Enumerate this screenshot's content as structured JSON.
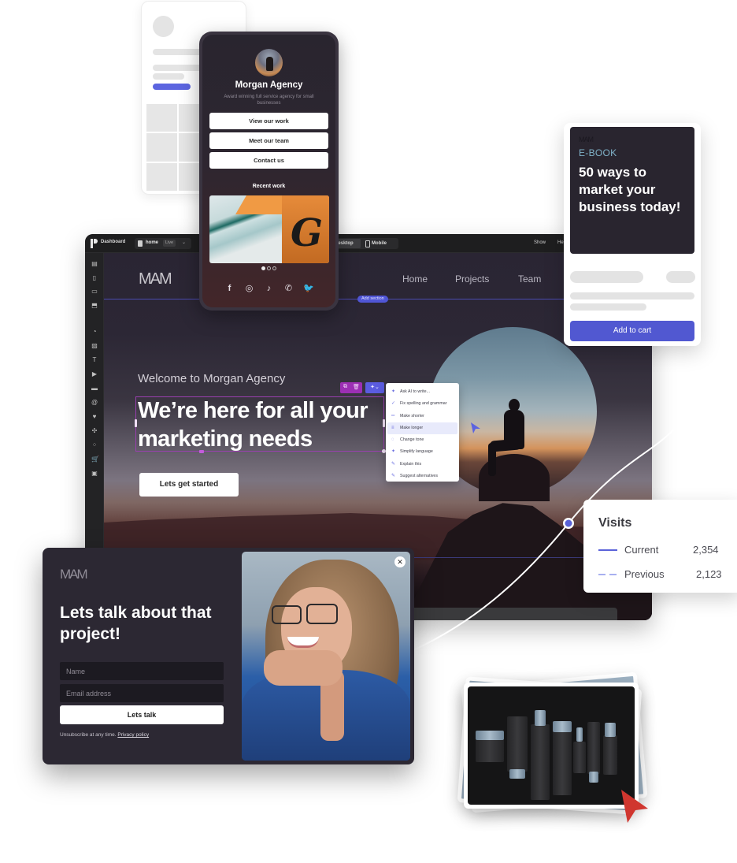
{
  "wireframe_card": {},
  "mobile_preview": {
    "title": "Morgan Agency",
    "subtitle": "Award winning full service agency for small businesses",
    "buttons": [
      "View our work",
      "Meet our team",
      "Contact us"
    ],
    "recent_work_label": "Recent work",
    "carousel": {
      "total": 3,
      "active": 1
    },
    "social_icons": [
      "facebook-icon",
      "instagram-icon",
      "tiktok-icon",
      "whatsapp-icon",
      "twitter-icon"
    ],
    "social_glyphs": [
      "f",
      "◎",
      "♪",
      "✆",
      "🐦"
    ]
  },
  "editor": {
    "topbar": {
      "dashboard_label": "Dashboard",
      "page_name": "home",
      "page_status": "Live",
      "device_desktop": "Desktop",
      "device_mobile": "Mobile",
      "show_label": "Show",
      "help_label": "He"
    },
    "sidebar_icons": [
      "pages-icon",
      "page-icon",
      "section-icon",
      "bookmark-icon",
      "shapes-icon",
      "image-icon",
      "text-icon",
      "video-icon",
      "button-icon",
      "email-icon",
      "heart-icon",
      "widget-icon",
      "apps-icon",
      "cart-icon",
      "gallery-icon"
    ],
    "site": {
      "logo": "MAM",
      "nav": [
        "Home",
        "Projects",
        "Team"
      ],
      "add_section_label": "Add section",
      "welcome": "Welcome to Morgan Agency",
      "headline": "We’re here for all your marketing needs",
      "cta": "Lets get started"
    },
    "ai_menu": {
      "items": [
        {
          "label": "Ask AI to write...",
          "icon": "sparkle-icon",
          "glyph": "✦"
        },
        {
          "label": "Fix spelling and grammar",
          "icon": "check-icon",
          "glyph": "✓"
        },
        {
          "label": "Make shorter",
          "icon": "shorten-icon",
          "glyph": "═"
        },
        {
          "label": "Make longer",
          "icon": "lengthen-icon",
          "glyph": "≡",
          "active": true
        },
        {
          "label": "Change tone",
          "icon": "tone-icon",
          "glyph": "◌"
        },
        {
          "label": "Simplify language",
          "icon": "sparkle-icon",
          "glyph": "✦"
        },
        {
          "label": "Explain this",
          "icon": "pen-icon",
          "glyph": "✎"
        },
        {
          "label": "Suggest alternatives",
          "icon": "pen-icon",
          "glyph": "✎"
        }
      ]
    }
  },
  "ebook": {
    "logo": "MAM",
    "tag": "E-BOOK",
    "title": "50 ways to market your business today!",
    "button": "Add to cart"
  },
  "visits": {
    "title": "Visits",
    "rows": [
      {
        "label": "Current",
        "value": "2,354",
        "color": "#5b63d9",
        "style": "solid"
      },
      {
        "label": "Previous",
        "value": "2,123",
        "color": "#a8b0f0",
        "style": "dashed"
      }
    ]
  },
  "popup": {
    "logo": "MAM",
    "title": "Lets talk about that project!",
    "name_placeholder": "Name",
    "email_placeholder": "Email address",
    "button": "Lets talk",
    "footer_text": "Unsubscribe at any time.",
    "privacy_link": "Privacy policy"
  },
  "colors": {
    "accent": "#5158d1",
    "selection": "#9c2fb4",
    "dark_bg": "#2c2833",
    "cursor_red": "#d0362f"
  }
}
